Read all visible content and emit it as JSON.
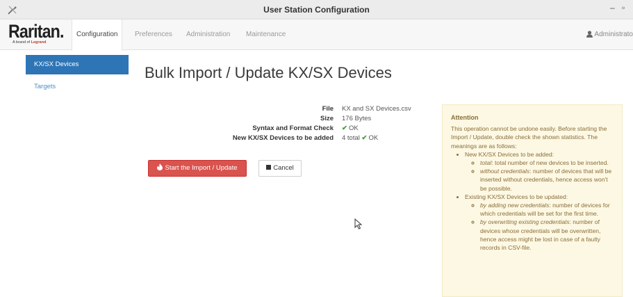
{
  "window": {
    "title": "User Station Configuration",
    "minimize": "–",
    "maximize": "▫"
  },
  "brand": {
    "name": "Raritan.",
    "tagline_prefix": "A brand of",
    "tagline_brand": "Legrand"
  },
  "nav": {
    "tabs": [
      {
        "label": "Configuration",
        "active": true
      },
      {
        "label": "Preferences",
        "active": false
      },
      {
        "label": "Administration",
        "active": false
      },
      {
        "label": "Maintenance",
        "active": false
      }
    ],
    "user": "Administrato"
  },
  "sidebar": {
    "items": [
      {
        "label": "KX/SX Devices",
        "active": true
      },
      {
        "label": "Targets",
        "active": false
      }
    ]
  },
  "main": {
    "title": "Bulk Import / Update KX/SX Devices",
    "info": {
      "file_label": "File",
      "file_value": "KX and SX Devices.csv",
      "size_label": "Size",
      "size_value": "176 Bytes",
      "syntax_label": "Syntax and Format Check",
      "syntax_value": "OK",
      "new_label": "New KX/SX Devices to be added",
      "new_count": "4 total",
      "new_status": "OK"
    },
    "start_button": "Start the Import / Update",
    "cancel_button": "Cancel"
  },
  "attention": {
    "heading": "Attention",
    "intro": "This operation cannot be undone easily. Before starting the Import / Update, double check the shown statistics. The meanings are as follows:",
    "new_heading": "New KX/SX Devices to be added:",
    "new_total_term": "total",
    "new_total_desc": ": total number of new devices to be inserted.",
    "new_without_term": "without credentials",
    "new_without_desc": ": number of devices that will be inserted without credentials, hence access won't be possible.",
    "existing_heading": "Existing KX/SX Devices to be updated:",
    "existing_adding_term": "by adding new credentials",
    "existing_adding_desc": ": number of devices for which credentials will be set for the first time.",
    "existing_overwriting_term": "by overwriting existing credentials",
    "existing_overwriting_desc": ": number of devices whose credentials will be overwritten, hence access might be lost in case of a faulty records in CSV-file."
  },
  "colors": {
    "primary_blue": "#2e75b6",
    "danger_red": "#d9534f",
    "ok_green": "#3a9d3a",
    "attention_bg": "#fcf8e3"
  },
  "icons": {
    "app": "tools-icon",
    "user": "user-icon",
    "start": "fire-icon",
    "cancel": "stop-icon",
    "check": "check-icon"
  }
}
